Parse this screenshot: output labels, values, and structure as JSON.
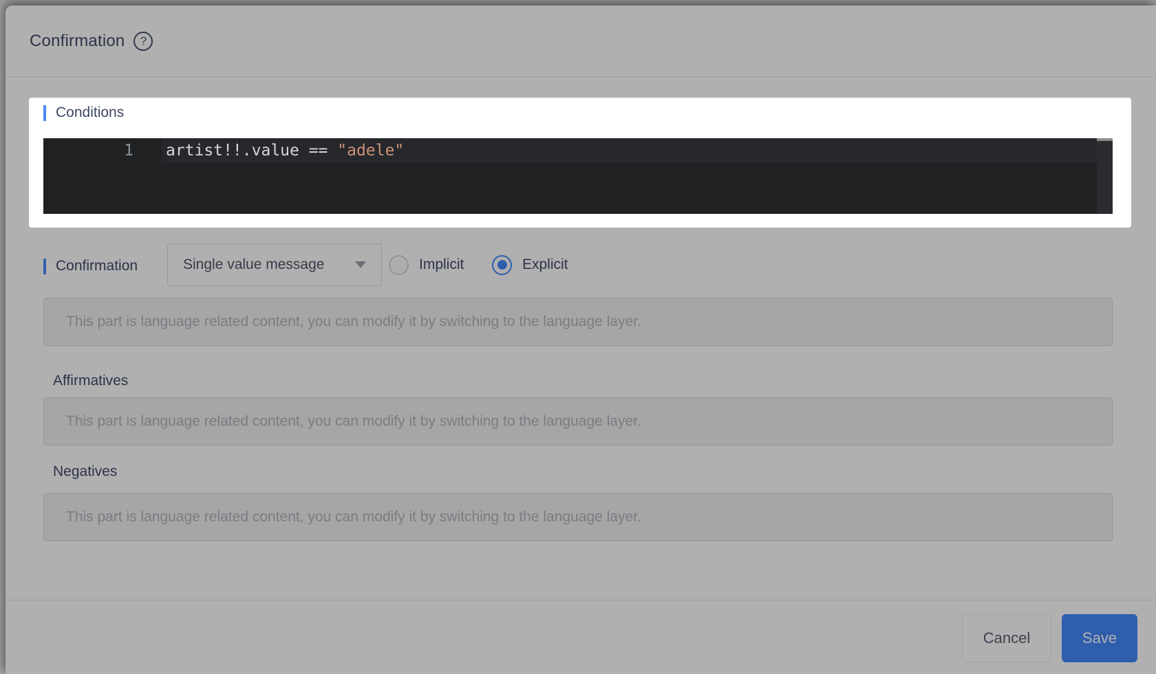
{
  "header": {
    "title": "Confirmation",
    "help_glyph": "?"
  },
  "spotlight": {
    "section_label": "Conditions",
    "editor": {
      "line_number": "1",
      "code_expression": "artist!!.value == ",
      "code_string": "\"adele\""
    }
  },
  "confirmation": {
    "section_label": "Confirmation",
    "type_dropdown": {
      "selected_value": "Single value message"
    },
    "mode_radios": [
      {
        "label": "Implicit",
        "selected": false
      },
      {
        "label": "Explicit",
        "selected": true
      }
    ]
  },
  "language_content": {
    "disabled_message": "This part is language related content, you can modify it by switching to the language layer.",
    "affirmatives_label": "Affirmatives",
    "negatives_label": "Negatives"
  },
  "footer": {
    "cancel_label": "Cancel",
    "save_label": "Save"
  },
  "colors": {
    "accent_blue": "#4a89f8",
    "primary_blue": "#4187fa",
    "editor_background": "#1f2123",
    "code_text_color": "#d5d7d9",
    "code_string_color": "#ce9178"
  }
}
